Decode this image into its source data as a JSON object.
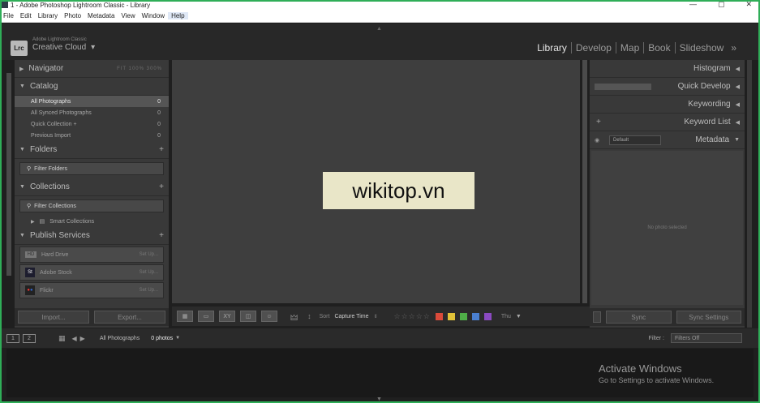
{
  "window": {
    "title": "1 - Adobe Photoshop Lightroom Classic - Library",
    "controls": [
      "—",
      "▢",
      "✕"
    ]
  },
  "menu": [
    "File",
    "Edit",
    "Library",
    "Photo",
    "Metadata",
    "View",
    "Window",
    "Help"
  ],
  "identity": {
    "badge": "Lrc",
    "product": "Adobe Lightroom Classic",
    "plate": "Creative Cloud",
    "plate_arrow": "▾"
  },
  "modules": [
    "Library",
    "Develop",
    "Map",
    "Book",
    "Slideshow"
  ],
  "modules_more": "»",
  "left": {
    "navigator": {
      "label": "Navigator",
      "zoom": "FIT   100%   300%"
    },
    "catalog": {
      "label": "Catalog",
      "rows": [
        {
          "label": "All Photographs",
          "count": "0"
        },
        {
          "label": "All Synced Photographs",
          "count": "0"
        },
        {
          "label": "Quick Collection +",
          "count": "0"
        },
        {
          "label": "Previous Import",
          "count": "0"
        }
      ]
    },
    "folders": {
      "label": "Folders",
      "filter": "Filter Folders"
    },
    "collections": {
      "label": "Collections",
      "filter": "Filter Collections",
      "smart": "Smart Collections"
    },
    "publish": {
      "label": "Publish Services",
      "services": [
        {
          "name": "Hard Drive",
          "icon": "HD",
          "setup": "Set Up..."
        },
        {
          "name": "Adobe Stock",
          "icon": "St",
          "setup": "Set Up..."
        },
        {
          "name": "Flickr",
          "icon": "●●",
          "setup": "Set Up..."
        }
      ]
    },
    "import_label": "Import...",
    "export_label": "Export..."
  },
  "center": {
    "watermark": "wikitop.vn",
    "sort_label": "Sort",
    "sort_value": "Capture Time",
    "stars": "☆☆☆☆☆",
    "thumb_label": "Thu"
  },
  "color_labels": [
    "#d94a3a",
    "#e0c238",
    "#4fae48",
    "#4a7fd0",
    "#8a4ac0"
  ],
  "right": {
    "histogram": "Histogram",
    "quick_develop": "Quick Develop",
    "keywording": "Keywording",
    "keyword_list": "Keyword List",
    "metadata": "Metadata",
    "metadata_preset": "Default",
    "metadata_empty": "No photo selected",
    "sync_label": "Sync",
    "sync_settings_label": "Sync Settings"
  },
  "filmstrip": {
    "screen1": "1",
    "screen2": "2",
    "source": "All Photographs",
    "count": "0 photos",
    "filter_label": "Filter :",
    "filter_value": "Filters Off"
  },
  "activation": {
    "line1": "Activate Windows",
    "line2": "Go to Settings to activate Windows."
  }
}
